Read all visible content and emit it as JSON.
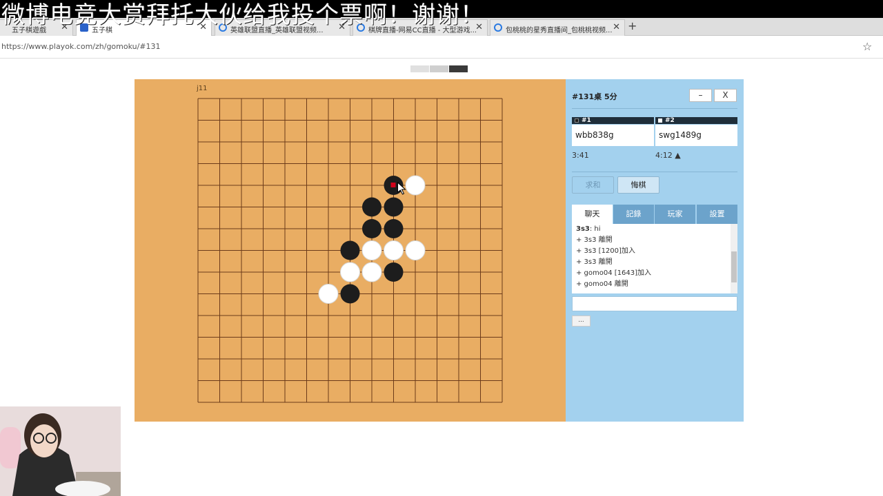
{
  "overlay": {
    "banner_text": "微博电竞大赏拜托大伙给我投个票啊！谢谢！"
  },
  "browser": {
    "tabs": [
      {
        "title": "五子棋遊戲",
        "active": false
      },
      {
        "title": "五子棋",
        "active": true
      },
      {
        "title": "英雄联盟直播_英雄联盟视频...",
        "active": false
      },
      {
        "title": "棋牌直播-网易CC直播 - 大型游戏...",
        "active": false
      },
      {
        "title": "包桃桃的星秀直播间_包桃桃视频...",
        "active": false
      }
    ],
    "new_tab": "+",
    "close_glyph": "✕",
    "url": "https://www.playok.com/zh/gomoku/#131",
    "star_glyph": "☆"
  },
  "board": {
    "last_move_label": "j11",
    "size": 15,
    "colors": {
      "board": "#e9ad63",
      "line": "#6b3a1a",
      "black": "#1d1d1d",
      "white": "#ffffff",
      "last_marker": "#d0021b"
    },
    "black_stones": [
      [
        9,
        4
      ],
      [
        8,
        5
      ],
      [
        9,
        5
      ],
      [
        8,
        6
      ],
      [
        9,
        6
      ],
      [
        7,
        7
      ],
      [
        9,
        8
      ],
      [
        7,
        9
      ]
    ],
    "white_stones": [
      [
        10,
        4
      ],
      [
        8,
        7
      ],
      [
        9,
        7
      ],
      [
        10,
        7
      ],
      [
        7,
        8
      ],
      [
        8,
        8
      ],
      [
        6,
        9
      ]
    ],
    "last_move": [
      9,
      4
    ]
  },
  "panel": {
    "table_title": "#131桌   5分",
    "minimize": "–",
    "close": "X",
    "players": [
      {
        "seat": "#1",
        "name": "wbb838g",
        "time": "3:41",
        "seat_color": "#1d1d1d"
      },
      {
        "seat": "#2",
        "name": "swg1489g",
        "time": "4:12 ▲",
        "seat_color": "#ffffff"
      }
    ],
    "draw_button": "求和",
    "undo_button": "悔棋",
    "tabs": [
      "聊天",
      "記錄",
      "玩家",
      "設置"
    ],
    "chat": [
      {
        "user": "3s3",
        "text": ": hi"
      },
      {
        "user": "",
        "text": "+ 3s3 離開"
      },
      {
        "user": "",
        "text": "+ 3s3 [1200]加入"
      },
      {
        "user": "",
        "text": "+ 3s3 離開"
      },
      {
        "user": "",
        "text": "+ gomo04 [1643]加入"
      },
      {
        "user": "",
        "text": "+ gomo04 離開"
      }
    ],
    "more_button": "..."
  }
}
